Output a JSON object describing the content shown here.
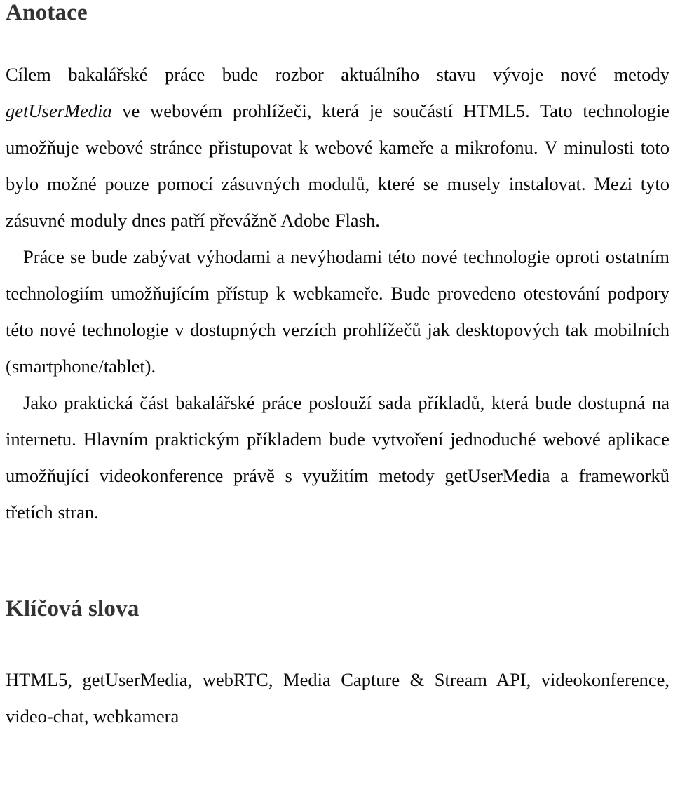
{
  "document": {
    "language": "cs",
    "sections": [
      {
        "id": "abstract",
        "heading": "Anotace",
        "paragraphs": [
          {
            "id": "p1",
            "indented": false,
            "runs": [
              {
                "style": "normal",
                "text": "Cílem bakalářské práce bude rozbor aktuálního stavu vývoje nové metody "
              },
              {
                "style": "italic",
                "text": "getUserMedia"
              },
              {
                "style": "normal",
                "text": " ve webovém prohlížeči, která je součástí HTML5. Tato technologie umožňuje webové stránce přistupovat k webové kameře a mikrofonu. V minulosti toto bylo možné pouze pomocí zásuvných modulů, které se musely instalovat. Mezi tyto zásuvné moduly dnes patří převážně Adobe Flash."
              }
            ]
          },
          {
            "id": "p2",
            "indented": true,
            "runs": [
              {
                "style": "normal",
                "text": "Práce se bude zabývat výhodami a nevýhodami této nové technologie oproti ostatním technologiím umožňujícím přístup k webkameře. Bude provedeno otestování podpory této nové technologie v dostupných verzích prohlížečů jak desktopových tak mobilních (smartphone/tablet)."
              }
            ]
          },
          {
            "id": "p3",
            "indented": true,
            "runs": [
              {
                "style": "normal",
                "text": "Jako praktická část bakalářské práce poslouží sada příkladů, která bude dostupná na internetu. Hlavním praktickým příkladem bude vytvoření jednoduché webové aplikace umožňující videokonference právě s využitím metody getUserMedia a frameworků třetích stran."
              }
            ]
          }
        ]
      },
      {
        "id": "keywords",
        "heading": "Klíčová slova",
        "paragraphs": [
          {
            "id": "kw1",
            "indented": false,
            "runs": [
              {
                "style": "normal",
                "text": "HTML5, getUserMedia, webRTC, Media Capture & Stream API, videokonference, video-chat, webkamera"
              }
            ]
          }
        ]
      }
    ]
  },
  "style": {
    "heading_color": "#333333",
    "body_color": "#0b0b0b",
    "page_background": "#ffffff"
  }
}
